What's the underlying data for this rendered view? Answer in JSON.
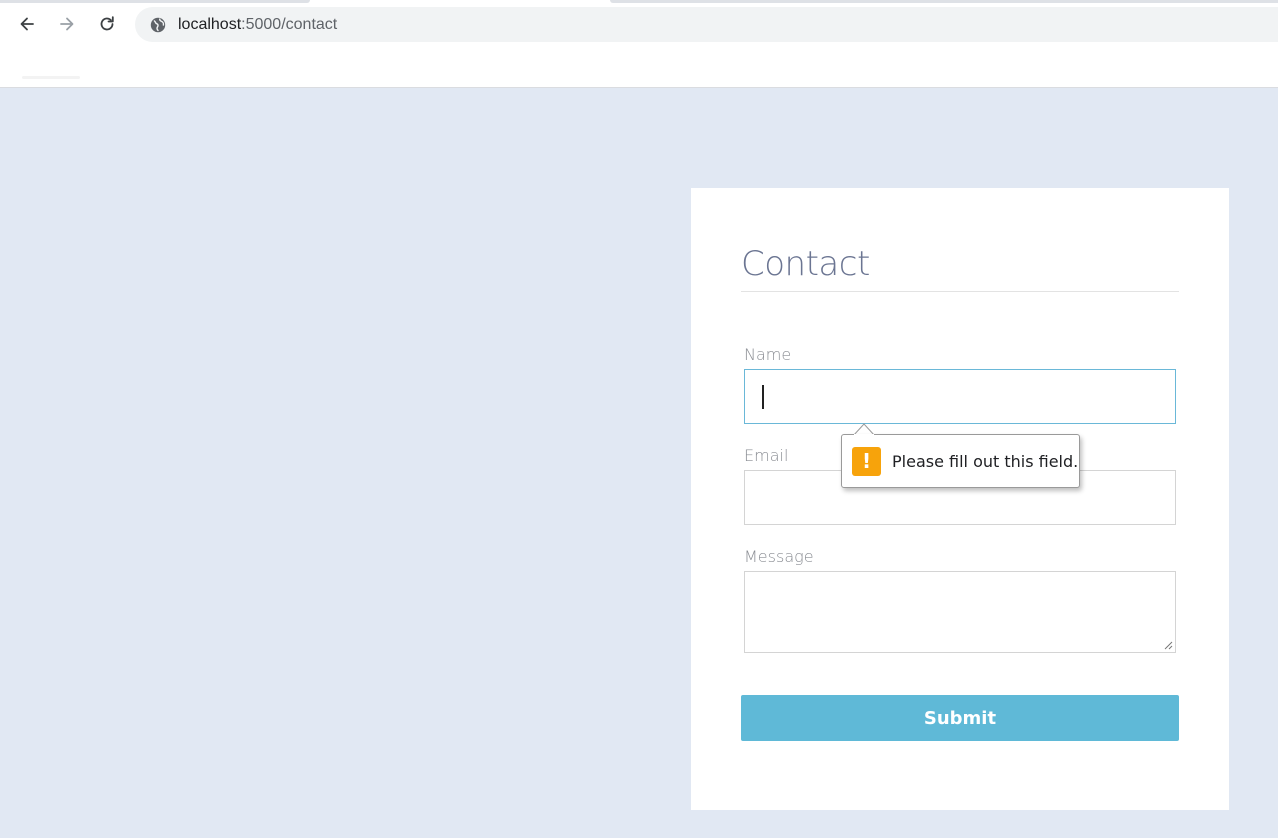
{
  "browser": {
    "url_host": "localhost",
    "url_path": ":5000/contact",
    "back_icon": "arrow-left-icon",
    "forward_icon": "arrow-right-icon",
    "reload_icon": "reload-icon",
    "site_icon": "globe-icon"
  },
  "form": {
    "title": "Contact",
    "fields": [
      {
        "label": "Name",
        "value": ""
      },
      {
        "label": "Email",
        "value": ""
      },
      {
        "label": "Message",
        "value": ""
      }
    ],
    "submit_label": "Submit"
  },
  "validation": {
    "message": "Please fill out this field.",
    "icon": "warning-icon",
    "icon_glyph": "!"
  },
  "colors": {
    "page_bg": "#e1e8f3",
    "submit_bg": "#5fb9d7",
    "warning": "#f7a30b",
    "focus_border": "#6ab8d8"
  }
}
